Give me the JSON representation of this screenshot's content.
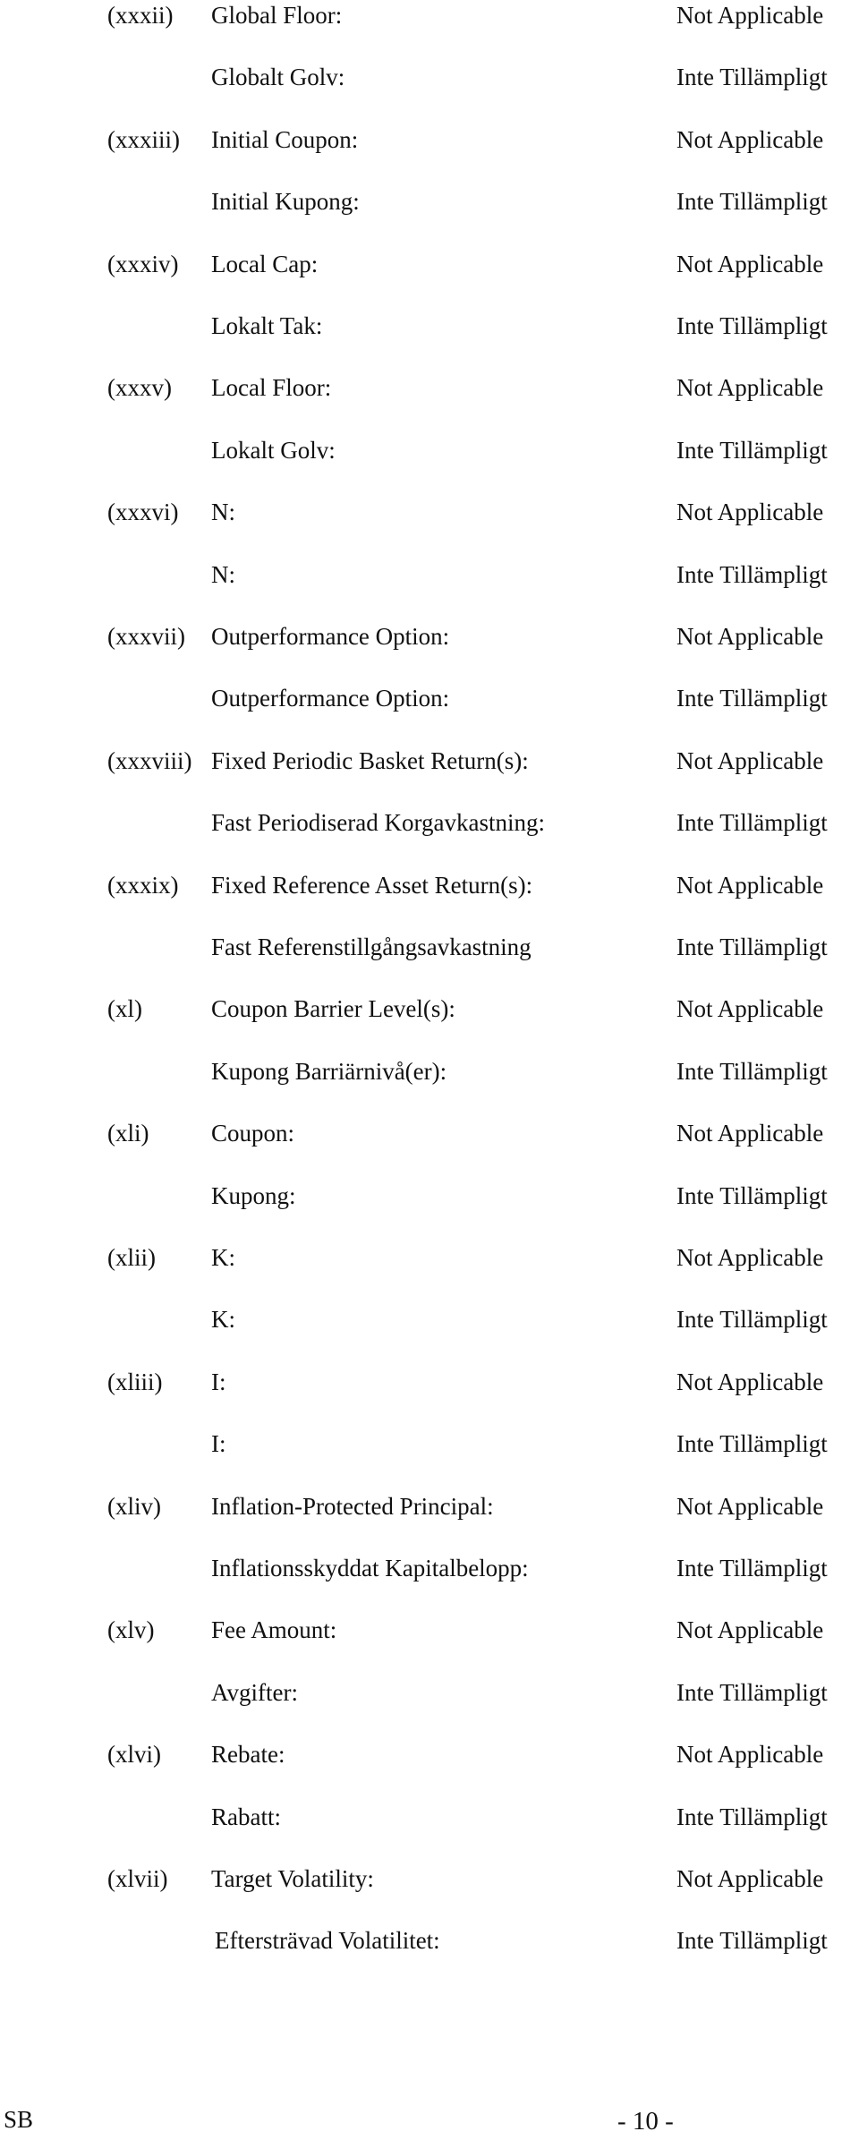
{
  "rows": [
    {
      "num": "(xxxii)",
      "label": "Global Floor:",
      "value": "Not Applicable"
    },
    {
      "num": "",
      "label": "Globalt Golv:",
      "value": "Inte Tillämpligt"
    },
    {
      "num": "(xxxiii)",
      "label": "Initial Coupon:",
      "value": "Not Applicable"
    },
    {
      "num": "",
      "label": "Initial Kupong:",
      "value": "Inte Tillämpligt"
    },
    {
      "num": "(xxxiv)",
      "label": "Local Cap:",
      "value": "Not Applicable"
    },
    {
      "num": "",
      "label": "Lokalt Tak:",
      "value": "Inte Tillämpligt"
    },
    {
      "num": "(xxxv)",
      "label": "Local Floor:",
      "value": "Not Applicable"
    },
    {
      "num": "",
      "label": "Lokalt Golv:",
      "value": "Inte Tillämpligt"
    },
    {
      "num": "(xxxvi)",
      "label": "N:",
      "value": "Not Applicable"
    },
    {
      "num": "",
      "label": "N:",
      "value": "Inte Tillämpligt"
    },
    {
      "num": "(xxxvii)",
      "label": "Outperformance Option:",
      "value": "Not Applicable"
    },
    {
      "num": "",
      "label": "Outperformance Option:",
      "value": "Inte Tillämpligt"
    },
    {
      "num": "(xxxviii)",
      "label": "Fixed Periodic Basket Return(s):",
      "value": "Not Applicable"
    },
    {
      "num": "",
      "label": "Fast Periodiserad Korgavkastning:",
      "value": "Inte Tillämpligt"
    },
    {
      "num": "(xxxix)",
      "label": "Fixed Reference Asset Return(s):",
      "value": "Not Applicable"
    },
    {
      "num": "",
      "label": "Fast Referenstillgångsavkastning",
      "value": "Inte Tillämpligt"
    },
    {
      "num": "(xl)",
      "label": "Coupon Barrier Level(s):",
      "value": "Not Applicable"
    },
    {
      "num": "",
      "label": "Kupong Barriärnivå(er):",
      "value": "Inte Tillämpligt"
    },
    {
      "num": "(xli)",
      "label": "Coupon:",
      "value": "Not Applicable"
    },
    {
      "num": "",
      "label": "Kupong:",
      "value": "Inte Tillämpligt"
    },
    {
      "num": "(xlii)",
      "label": "K:",
      "value": "Not Applicable"
    },
    {
      "num": "",
      "label": "K:",
      "value": "Inte Tillämpligt"
    },
    {
      "num": "(xliii)",
      "label": "I:",
      "value": "Not Applicable"
    },
    {
      "num": "",
      "label": "I:",
      "value": "Inte Tillämpligt"
    },
    {
      "num": "(xliv)",
      "label": "Inflation-Protected Principal:",
      "value": "Not Applicable"
    },
    {
      "num": "",
      "label": "Inflationsskyddat Kapitalbelopp:",
      "value": "Inte Tillämpligt"
    },
    {
      "num": "(xlv)",
      "label": "Fee Amount:",
      "value": "Not Applicable"
    },
    {
      "num": "",
      "label": "Avgifter:",
      "value": "Inte Tillämpligt"
    },
    {
      "num": "(xlvi)",
      "label": "Rebate:",
      "value": "Not Applicable"
    },
    {
      "num": "",
      "label": "Rabatt:",
      "value": "Inte Tillämpligt"
    },
    {
      "num": "(xlvii)",
      "label": "Target Volatility:",
      "value": "Not Applicable"
    },
    {
      "num": "",
      "label": "Eftersträvad Volatilitet:",
      "value": "Inte Tillämpligt"
    }
  ],
  "footer": {
    "left": "SB",
    "page_number": "- 10 -"
  }
}
